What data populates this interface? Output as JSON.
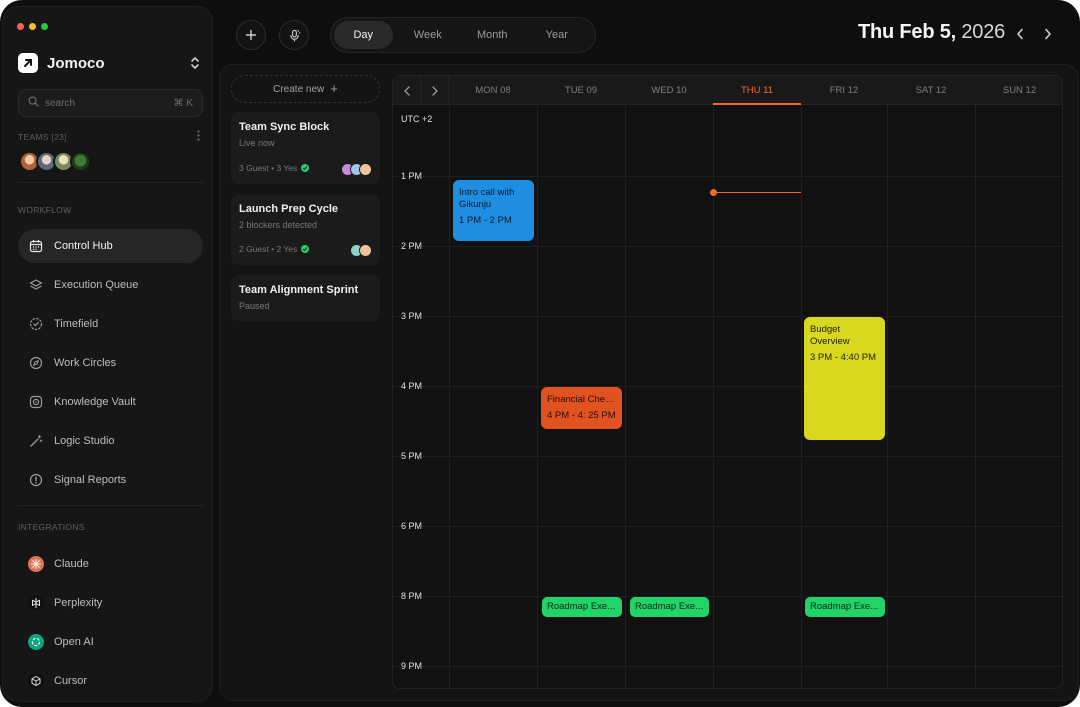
{
  "brand": {
    "name": "Jomoco"
  },
  "search": {
    "placeholder": "search",
    "shortcut": "⌘ K"
  },
  "teams": {
    "label": "TEAMS [23]"
  },
  "workflow": {
    "label": "WORKFLOW",
    "items": [
      {
        "label": "Control Hub",
        "icon": "calendar-icon",
        "active": true
      },
      {
        "label": "Execution Queue",
        "icon": "layers-icon"
      },
      {
        "label": "Timefield",
        "icon": "clock-check-icon"
      },
      {
        "label": "Work Circles",
        "icon": "compass-icon"
      },
      {
        "label": "Knowledge Vault",
        "icon": "vault-icon"
      },
      {
        "label": "Logic Studio",
        "icon": "magic-wand-icon"
      },
      {
        "label": "Signal Reports",
        "icon": "alert-circle-icon"
      }
    ]
  },
  "integrations": {
    "label": "INTEGRATIONS",
    "items": [
      {
        "label": "Claude",
        "icon": "claude-icon"
      },
      {
        "label": "Perplexity",
        "icon": "perplexity-icon"
      },
      {
        "label": "Open AI",
        "icon": "openai-icon"
      },
      {
        "label": "Cursor",
        "icon": "cursor-icon"
      }
    ]
  },
  "views": {
    "items": [
      "Day",
      "Week",
      "Month",
      "Year"
    ],
    "active": "Day"
  },
  "date": {
    "bold": "Thu Feb 5,",
    "year": " 2026"
  },
  "tasks": {
    "create_label": "Create new",
    "items": [
      {
        "title": "Team Sync Block",
        "subtitle": "Live now",
        "guests": "3 Guest",
        "yes": "3 Yes"
      },
      {
        "title": "Launch Prep Cycle",
        "subtitle": "2 blockers detected",
        "guests": "2 Guest",
        "yes": "2 Yes"
      },
      {
        "title": "Team Alignment Sprint",
        "subtitle": "Paused"
      }
    ]
  },
  "calendar": {
    "timezone": "UTC +2",
    "days": [
      "MON 08",
      "TUE 09",
      "WED 10",
      "THU 11",
      "FRI 12",
      "SAT 12",
      "SUN 12"
    ],
    "today": "THU 11",
    "hours": [
      "1 PM",
      "2 PM",
      "3 PM",
      "4 PM",
      "5 PM",
      "6 PM",
      "8 PM",
      "9 PM"
    ],
    "events": [
      {
        "title": "Intro call with Gikunju",
        "time": "1 PM - 2 PM",
        "color": "#1f8ee0",
        "text_color": "#0b1b2b"
      },
      {
        "title": "Financial Chec...",
        "time": "4 PM - 4: 25 PM",
        "color": "#e0521f",
        "text_color": "#2a0d03"
      },
      {
        "title": "Budget Overview",
        "time": "3 PM - 4:40 PM",
        "color": "#d8d81f",
        "text_color": "#222200"
      },
      {
        "title": "Roadmap Exe...",
        "color": "#22d36a",
        "text_color": "#062a14"
      },
      {
        "title": "Roadmap Exe...",
        "color": "#22d36a",
        "text_color": "#062a14"
      },
      {
        "title": "Roadmap Exe...",
        "color": "#22d36a",
        "text_color": "#062a14"
      }
    ]
  },
  "colors": {
    "accent": "#f06a2c",
    "background": "#0e0e0e",
    "panel": "#141414"
  }
}
